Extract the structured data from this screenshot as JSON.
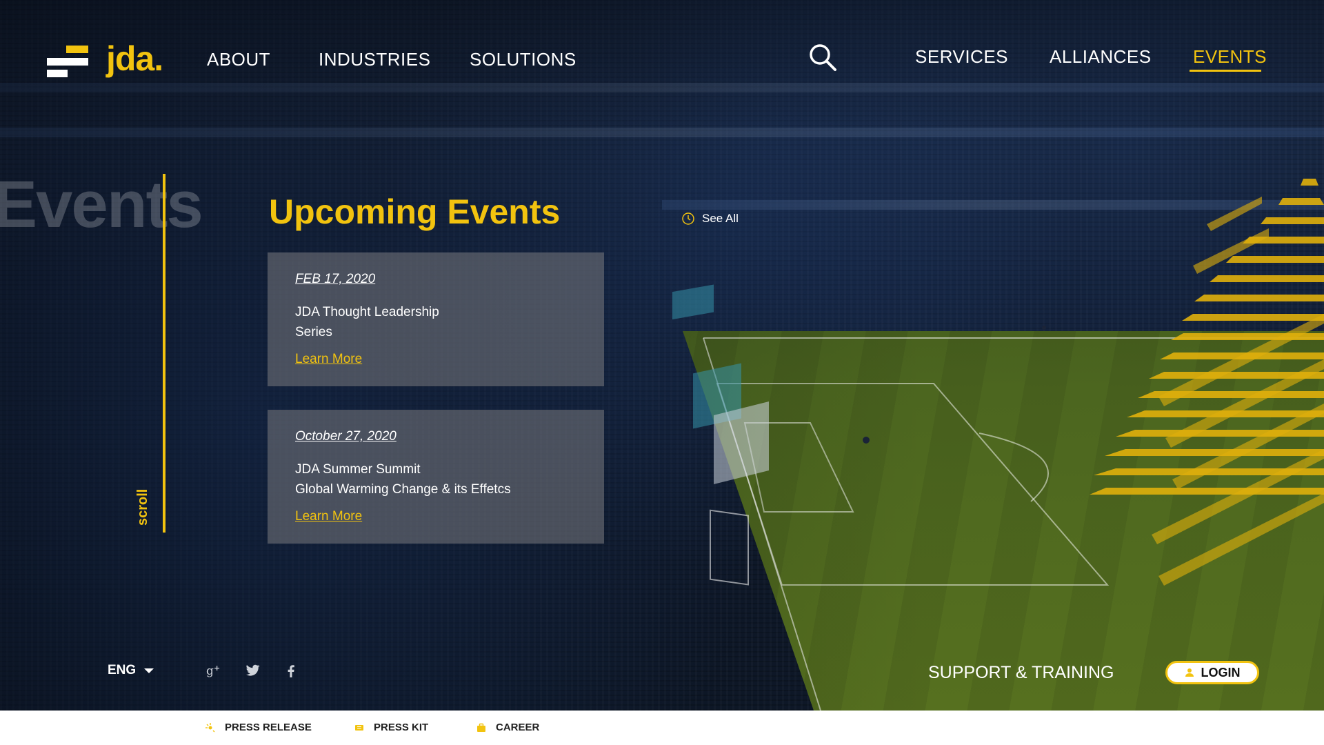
{
  "brand": {
    "logo_text": "jda.",
    "accent_color": "#f2c30f"
  },
  "nav_left": [
    "ABOUT",
    "INDUSTRIES",
    "SOLUTIONS"
  ],
  "nav_right": [
    "SERVICES",
    "ALLIANCES",
    "EVENTS"
  ],
  "nav_active": "EVENTS",
  "icons": {
    "search": "search-icon",
    "see_all": "clock-icon",
    "login": "user-icon"
  },
  "side": {
    "ghost_title": "Events",
    "scroll_label": "scroll"
  },
  "events_section": {
    "title": "Upcoming Events",
    "see_all_label": "See All",
    "items": [
      {
        "date": "FEB 17, 2020",
        "title_line1": "JDA Thought Leadership",
        "title_line2": "Series",
        "link_label": "Learn More"
      },
      {
        "date": "October 27, 2020",
        "title_line1": "JDA Summer Summit",
        "title_line2": "Global Warming Change & its Effetcs",
        "link_label": "Learn More"
      }
    ]
  },
  "footer": {
    "language": "ENG",
    "social": [
      "google-plus-icon",
      "twitter-icon",
      "facebook-icon"
    ],
    "support_label": "SUPPORT & TRAINING",
    "login_label": "LOGIN"
  },
  "bottom_bar": [
    {
      "label": "PRESS RELEASE",
      "icon": "sparkle-icon"
    },
    {
      "label": "PRESS KIT",
      "icon": "ticket-icon"
    },
    {
      "label": "CAREER",
      "icon": "briefcase-icon"
    }
  ]
}
